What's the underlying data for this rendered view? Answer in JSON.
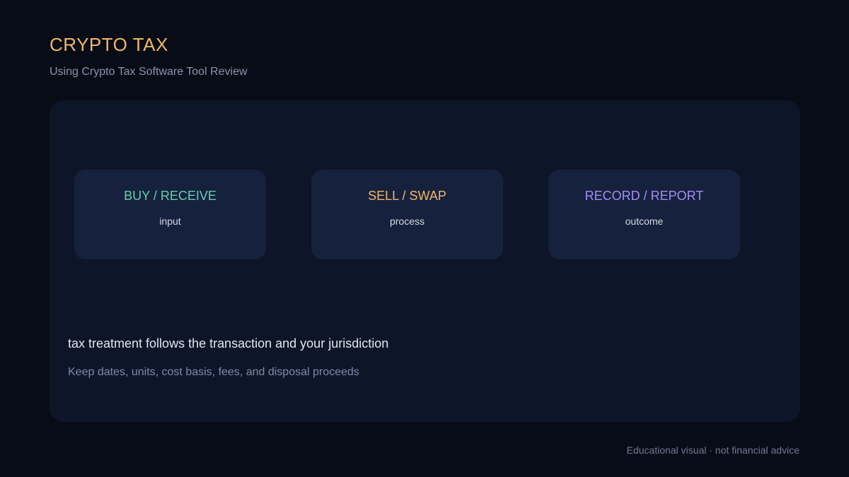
{
  "header": {
    "title": "CRYPTO TAX",
    "subtitle": "Using Crypto Tax Software Tool Review"
  },
  "flow": {
    "steps": [
      {
        "label": "BUY / RECEIVE",
        "sublabel": "input",
        "color": "#5fd2b0"
      },
      {
        "label": "SELL / SWAP",
        "sublabel": "process",
        "color": "#f2b766"
      },
      {
        "label": "RECORD / REPORT",
        "sublabel": "outcome",
        "color": "#a58cf5"
      }
    ]
  },
  "notes": {
    "main": "tax treatment follows the transaction and your jurisdiction",
    "detail": "Keep dates, units, cost basis, fees, and disposal proceeds"
  },
  "footer": {
    "disclaimer": "Educational visual · not financial advice"
  },
  "colors": {
    "background": "#080c16",
    "panel": "#0d1528",
    "card": "#16213d",
    "accent_title": "#f2b766"
  }
}
